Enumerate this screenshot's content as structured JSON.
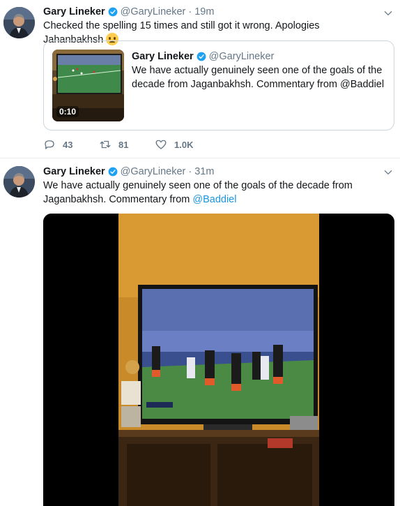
{
  "tweets": [
    {
      "author": {
        "name": "Gary Lineker",
        "handle": "@GaryLineker"
      },
      "time": "19m",
      "text": "Checked the spelling 15 times and still got it wrong. Apologies Jahanbakhsh",
      "emoji": "frowning-face-emoji",
      "quoted": {
        "author": {
          "name": "Gary Lineker",
          "handle": "@GaryLineker"
        },
        "text": "We have actually genuinely seen one of the goals of the decade from Jaganbakhsh. Commentary from @Baddiel",
        "video_duration": "0:10"
      },
      "stats": {
        "replies": "43",
        "retweets": "81",
        "likes": "1.0K"
      }
    },
    {
      "author": {
        "name": "Gary Lineker",
        "handle": "@GaryLineker"
      },
      "time": "31m",
      "text_before": "We have actually genuinely seen one of the goals of the decade from Jaganbakhsh. Commentary from ",
      "mention": "@Baddiel"
    }
  ],
  "separator": "·",
  "icons": {
    "verified": "verified-badge-icon",
    "more": "chevron-down-icon",
    "reply": "reply-icon",
    "retweet": "retweet-icon",
    "like": "heart-icon"
  },
  "colors": {
    "accent": "#1da1f2",
    "link": "#1b95e0",
    "muted": "#657786",
    "text": "#14171a",
    "border": "#e6ecf0"
  }
}
